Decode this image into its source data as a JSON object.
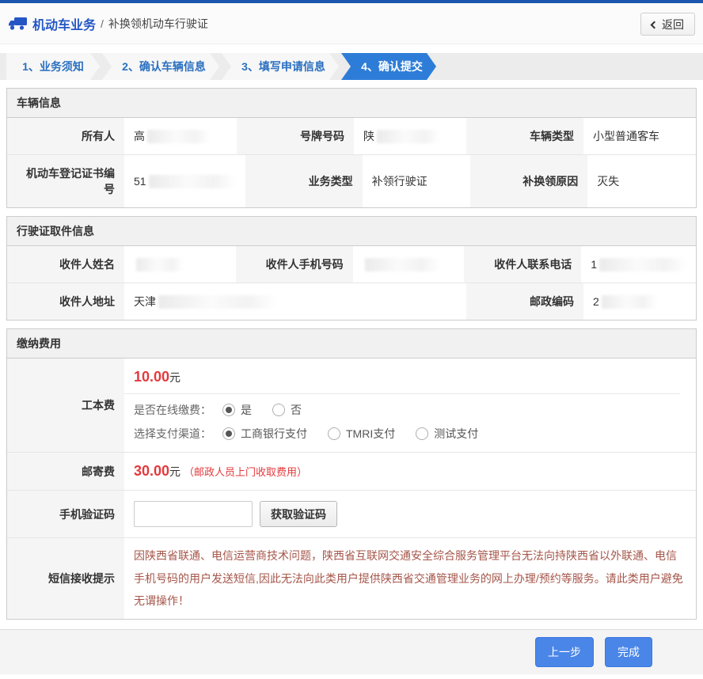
{
  "colors": {
    "top_border_blue": "#1b57ae",
    "brand_blue": "#2456c5",
    "step_active_blue": "#2d7dd8",
    "step_text_blue": "#2a6fc0",
    "button_blue": "#4a86e8",
    "fee_red": "#e4393c",
    "notice_red": "#a5564a"
  },
  "header": {
    "title_icon": "truck",
    "title": "机动车业务",
    "separator": "/",
    "subtitle": "补换领机动车行驶证",
    "back_icon": "chevron-left",
    "back_label": "返回"
  },
  "steps": [
    {
      "label": "1、业务须知",
      "active": false
    },
    {
      "label": "2、确认车辆信息",
      "active": false
    },
    {
      "label": "3、填写申请信息",
      "active": false
    },
    {
      "label": "4、确认提交",
      "active": true
    }
  ],
  "vehicle": {
    "title": "车辆信息",
    "fields": [
      {
        "label": "所有人",
        "value": "高",
        "redacted": true
      },
      {
        "label": "号牌号码",
        "value": "陕",
        "redacted": true
      },
      {
        "label": "车辆类型",
        "value": "小型普通客车",
        "redacted": false
      },
      {
        "label": "机动车登记证书编号",
        "value": "51",
        "redacted": true
      },
      {
        "label": "业务类型",
        "value": "补领行驶证",
        "redacted": false
      },
      {
        "label": "补换领原因",
        "value": "灭失",
        "redacted": false
      }
    ]
  },
  "delivery": {
    "title": "行驶证取件信息",
    "fields": [
      {
        "label": "收件人姓名",
        "value": "",
        "redacted": true
      },
      {
        "label": "收件人手机号码",
        "value": "",
        "redacted": true
      },
      {
        "label": "收件人联系电话",
        "value": "1",
        "redacted": true
      },
      {
        "label": "收件人地址",
        "value": "天津",
        "redacted": true
      },
      {
        "label": "邮政编码",
        "value": "2",
        "redacted": true
      }
    ]
  },
  "fees": {
    "title": "缴纳费用",
    "production_fee": {
      "label": "工本费",
      "amount": "10.00",
      "unit": "元",
      "online_question": "是否在线缴费：",
      "online_options": [
        {
          "label": "是",
          "checked": true
        },
        {
          "label": "否",
          "checked": false
        }
      ],
      "channel_question": "选择支付渠道：",
      "channel_options": [
        {
          "label": "工商银行支付",
          "checked": true
        },
        {
          "label": "TMRI支付",
          "checked": false
        },
        {
          "label": "测试支付",
          "checked": false
        }
      ]
    },
    "postage_fee": {
      "label": "邮寄费",
      "amount": "30.00",
      "unit": "元",
      "note": "（邮政人员上门收取费用）"
    },
    "sms_code": {
      "label": "手机验证码",
      "input_value": "",
      "button_label": "获取验证码"
    },
    "sms_notice": {
      "label": "短信接收提示",
      "text": "因陕西省联通、电信运营商技术问题，陕西省互联网交通安全综合服务管理平台无法向持陕西省以外联通、电信手机号码的用户发送短信,因此无法向此类用户提供陕西省交通管理业务的网上办理/预约等服务。请此类用户避免无谓操作！"
    }
  },
  "footer": {
    "prev_label": "上一步",
    "finish_label": "完成"
  }
}
